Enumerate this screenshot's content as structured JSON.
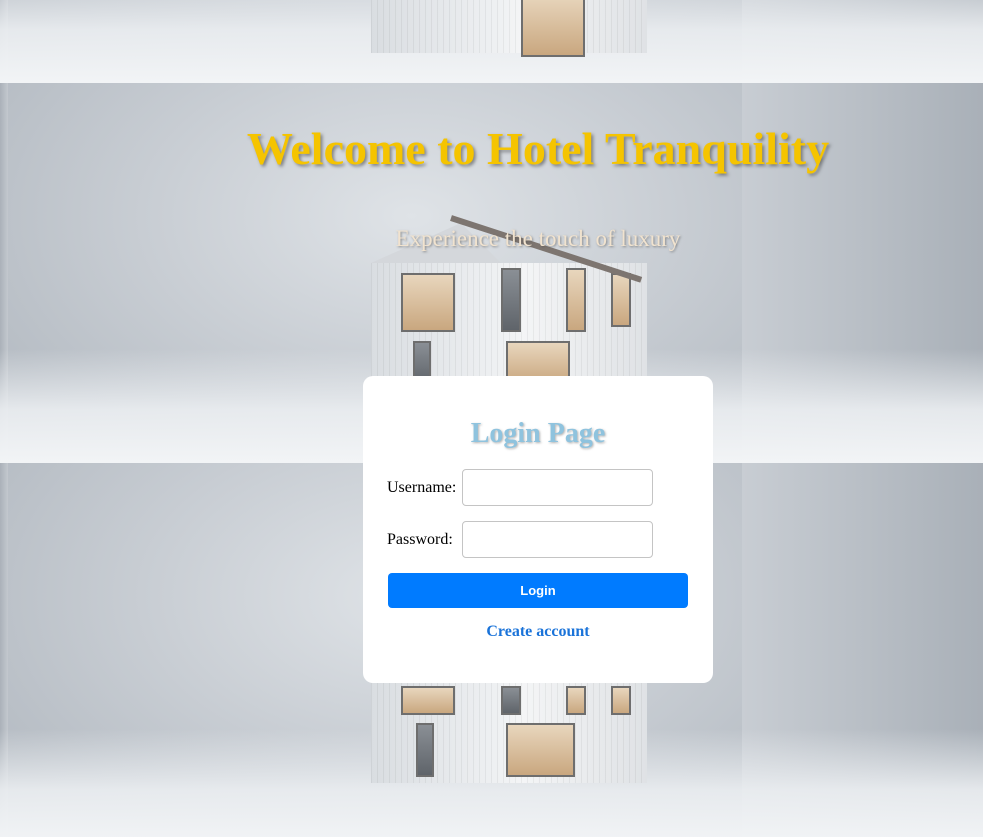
{
  "page": {
    "title": "Welcome to Hotel Tranquility",
    "subtitle": "Experience the touch of luxury"
  },
  "login": {
    "heading": "Login Page",
    "username_label": "Username:",
    "username_value": "",
    "password_label": "Password:",
    "password_value": "",
    "submit_label": "Login",
    "create_account_label": "Create account"
  },
  "colors": {
    "title": "#f5c400",
    "subtitle": "#f1e3cf",
    "login_heading": "#8fc3de",
    "button": "#007bff",
    "link": "#1a73d9"
  },
  "background": {
    "image_subject": "hotel-building-image"
  }
}
